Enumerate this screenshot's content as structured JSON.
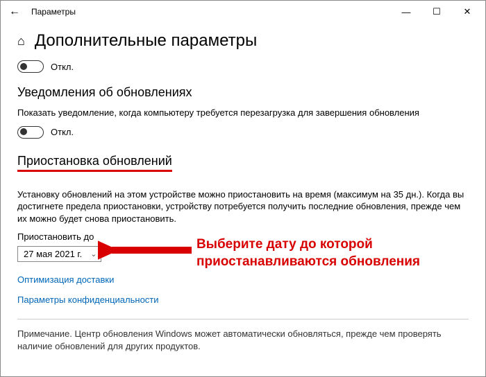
{
  "titlebar": {
    "back_glyph": "←",
    "title": "Параметры",
    "min": "—",
    "max": "☐",
    "close": "✕"
  },
  "header": {
    "home_glyph": "⌂",
    "page_title": "Дополнительные параметры"
  },
  "toggle1": {
    "label": "Откл."
  },
  "notifications": {
    "title": "Уведомления об обновлениях",
    "desc": "Показать уведомление, когда компьютеру требуется перезагрузка для завершения обновления",
    "toggle_label": "Откл."
  },
  "pause": {
    "title": "Приостановка обновлений",
    "desc": "Установку обновлений на этом устройстве можно приостановить на время (максимум на 35 дн.). Когда вы достигнете предела приостановки, устройству потребуется получить последние обновления, прежде чем их можно будет снова приостановить.",
    "field_label": "Приостановить до",
    "selected_date": "27 мая 2021 г.",
    "chev": "⌄"
  },
  "links": {
    "delivery": "Оптимизация доставки",
    "privacy": "Параметры конфиденциальности"
  },
  "footer": {
    "note": "Примечание. Центр обновления Windows может автоматически обновляться, прежде чем проверять наличие обновлений для других продуктов."
  },
  "annotation": {
    "line1": "Выберите дату до которой",
    "line2": "приостанавливаются обновления"
  }
}
